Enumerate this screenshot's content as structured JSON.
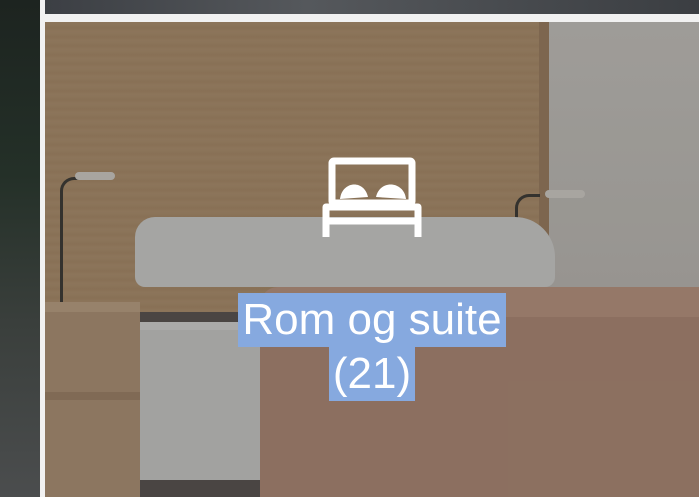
{
  "tile": {
    "title": "Rom og suite",
    "count": "(21)",
    "icon": "bed-icon"
  },
  "colors": {
    "selection_highlight": "#86a9df",
    "text": "#ffffff",
    "divider": "#f1f1f1"
  }
}
